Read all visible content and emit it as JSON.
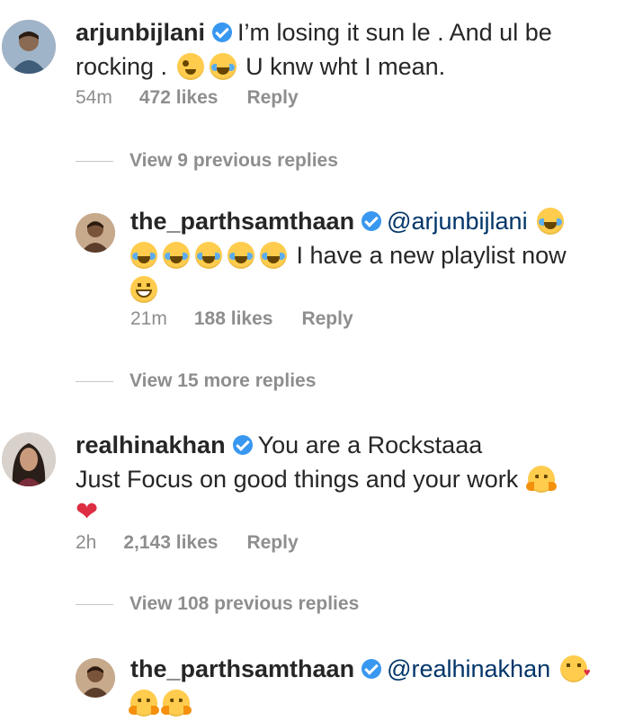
{
  "comments": [
    {
      "username": "arjunbijlani",
      "text_1": "I’m losing it sun le . And ul be",
      "text_2": "rocking .",
      "text_3": "U knw wht I mean.",
      "time": "54m",
      "likes": "472 likes",
      "reply": "Reply",
      "emoji": [
        "winking-face-with-tongue",
        "face-with-tears-of-joy"
      ]
    },
    {
      "username": "the_parthsamthaan",
      "mention": "@arjunbijlani",
      "text": "I have a new playlist now",
      "time": "21m",
      "likes": "188 likes",
      "reply": "Reply",
      "emoji": [
        "face-with-tears-of-joy",
        "face-with-tears-of-joy",
        "face-with-tears-of-joy",
        "face-with-tears-of-joy",
        "face-with-tears-of-joy",
        "face-with-tears-of-joy",
        "grinning-face"
      ]
    },
    {
      "username": "realhinakhan",
      "text_1": "You are a Rockstaaa",
      "text_2": "Just Focus on good things and your work",
      "time": "2h",
      "likes": "2,143 likes",
      "reply": "Reply",
      "emoji": [
        "hugging-face",
        "red-heart"
      ]
    },
    {
      "username": "the_parthsamthaan",
      "mention": "@realhinakhan",
      "emoji": [
        "face-blowing-a-kiss",
        "hugging-face",
        "hugging-face"
      ]
    }
  ],
  "view_replies": [
    "View 9 previous replies",
    "View 15 more replies",
    "View 108 previous replies"
  ],
  "colors": {
    "text": "#262626",
    "secondary": "#8e8e8e",
    "mention": "#003569",
    "verified": "#3897f0"
  }
}
